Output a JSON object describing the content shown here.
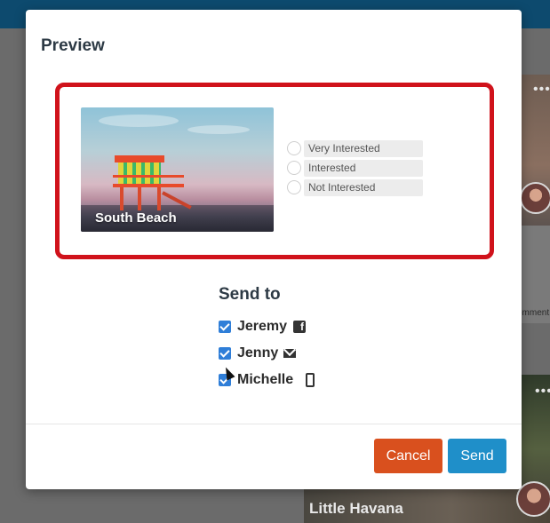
{
  "background": {
    "bottom_card_title": "Little Havana",
    "side_comment_text": "omment",
    "menu_dots": "•••"
  },
  "modal": {
    "title": "Preview",
    "preview": {
      "image_caption": "South Beach",
      "poll_options": [
        "Very Interested",
        "Interested",
        "Not Interested"
      ]
    },
    "send_to": {
      "title": "Send to",
      "recipients": [
        {
          "name": "Jeremy",
          "channel_icon": "facebook-icon",
          "checked": true
        },
        {
          "name": "Jenny",
          "channel_icon": "mail-icon",
          "checked": true
        },
        {
          "name": "Michelle",
          "channel_icon": "phone-icon",
          "checked": true
        }
      ]
    },
    "buttons": {
      "cancel_label": "Cancel",
      "send_label": "Send"
    }
  },
  "colors": {
    "highlight_border": "#d0121b",
    "cancel_button": "#d9501e",
    "send_button": "#1f8fc9",
    "checkbox": "#2f7ed8",
    "top_bar": "#0d4a6e"
  }
}
